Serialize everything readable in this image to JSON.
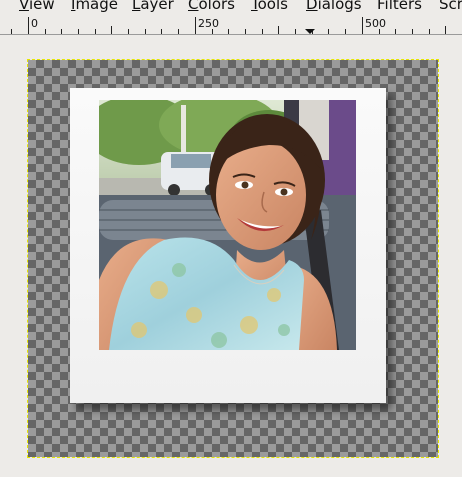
{
  "menu": {
    "items": [
      {
        "mnemonic": "V",
        "rest": "iew"
      },
      {
        "mnemonic": "I",
        "rest": "mage"
      },
      {
        "mnemonic": "L",
        "rest": "ayer"
      },
      {
        "mnemonic": "C",
        "rest": "olors"
      },
      {
        "mnemonic": "T",
        "rest": "ools"
      },
      {
        "mnemonic": "D",
        "rest": "ialogs"
      },
      {
        "mnemonic": "",
        "rest": "Filters"
      },
      {
        "mnemonic": "",
        "rest": "Scr"
      }
    ]
  },
  "ruler": {
    "labels": [
      "0",
      "250",
      "500"
    ]
  },
  "canvas": {
    "transparency_colors": [
      "#666666",
      "#9b9b9b"
    ],
    "selection_border_color": "#e6e600",
    "frame_style": "polaroid",
    "photo_subject": "smiling-woman-in-car-photo"
  }
}
